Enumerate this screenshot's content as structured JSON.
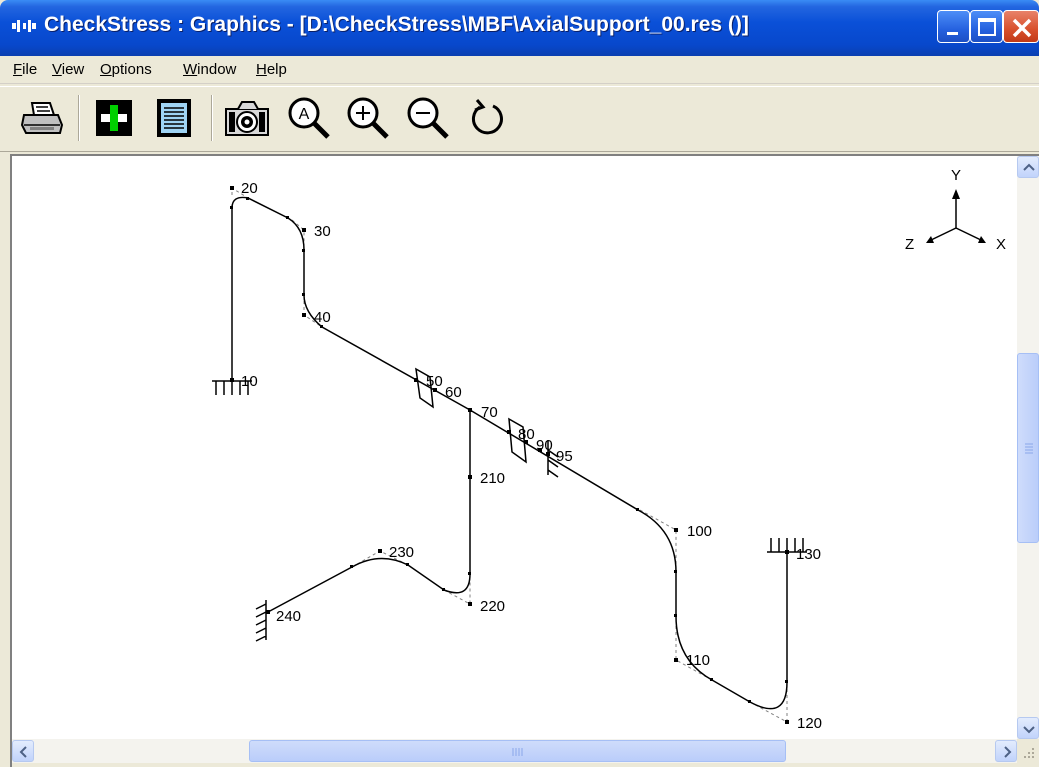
{
  "window": {
    "title": "CheckStress : Graphics -  [D:\\CheckStress\\MBF\\AxialSupport_00.res ()]"
  },
  "menu": {
    "items": [
      {
        "label": "File",
        "accel": "F"
      },
      {
        "label": "View",
        "accel": "V"
      },
      {
        "label": "Options",
        "accel": "O"
      },
      {
        "label": "Window",
        "accel": "W"
      },
      {
        "label": "Help",
        "accel": "H"
      }
    ]
  },
  "toolbar": {
    "tools": [
      "printer-icon",
      "node-toggle-icon",
      "report-icon",
      "camera-icon",
      "zoom-all-icon",
      "zoom-in-icon",
      "zoom-out-icon",
      "rotate-icon"
    ]
  },
  "axes": {
    "y": "Y",
    "z": "Z",
    "x": "X"
  },
  "nodes": [
    "20",
    "30",
    "40",
    "10",
    "50",
    "60",
    "70",
    "80",
    "90",
    "95",
    "210",
    "100",
    "130",
    "230",
    "220",
    "240",
    "110",
    "120"
  ],
  "colors": {
    "title_bar": "#0848cc",
    "menu_bg": "#ece9d8",
    "canvas_bg": "#ffffff",
    "pipe": "#000000",
    "construction": "#808080",
    "close_button": "#d8502c"
  }
}
